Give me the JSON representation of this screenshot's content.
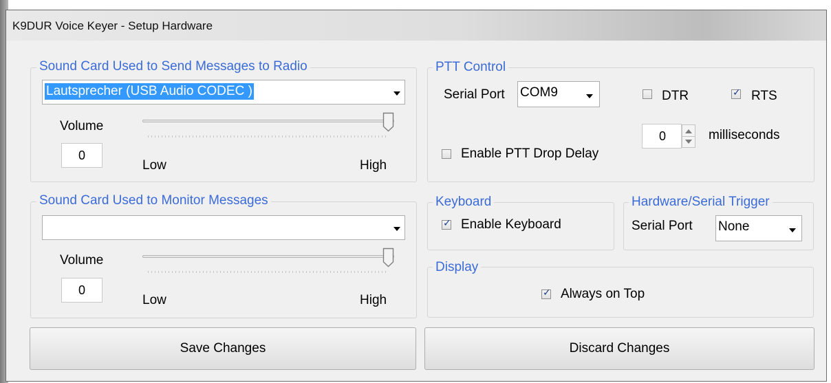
{
  "window": {
    "title": "K9DUR Voice Keyer - Setup Hardware"
  },
  "send_group": {
    "legend": "Sound Card Used to Send Messages to Radio",
    "device": "Lautsprecher (USB Audio CODEC )",
    "volume_label": "Volume",
    "volume_value": "0",
    "volume_level": 1.0,
    "low_label": "Low",
    "high_label": "High"
  },
  "monitor_group": {
    "legend": "Sound Card Used to Monitor Messages",
    "device": "",
    "volume_label": "Volume",
    "volume_value": "0",
    "volume_level": 1.0,
    "low_label": "Low",
    "high_label": "High"
  },
  "ptt": {
    "legend": "PTT Control",
    "serial_port_label": "Serial Port",
    "serial_port_value": "COM9",
    "dtr_label": "DTR",
    "dtr_checked": false,
    "rts_label": "RTS",
    "rts_checked": true,
    "delay_value": "0",
    "delay_unit": "milliseconds",
    "drop_delay_label": "Enable PTT Drop Delay",
    "drop_delay_checked": false
  },
  "keyboard": {
    "legend": "Keyboard",
    "enable_label": "Enable Keyboard",
    "enable_checked": true
  },
  "trigger": {
    "legend": "Hardware/Serial Trigger",
    "serial_port_label": "Serial Port",
    "serial_port_value": "None"
  },
  "display": {
    "legend": "Display",
    "always_on_top_label": "Always on Top",
    "always_on_top_checked": true
  },
  "buttons": {
    "save": "Save Changes",
    "discard": "Discard Changes"
  }
}
